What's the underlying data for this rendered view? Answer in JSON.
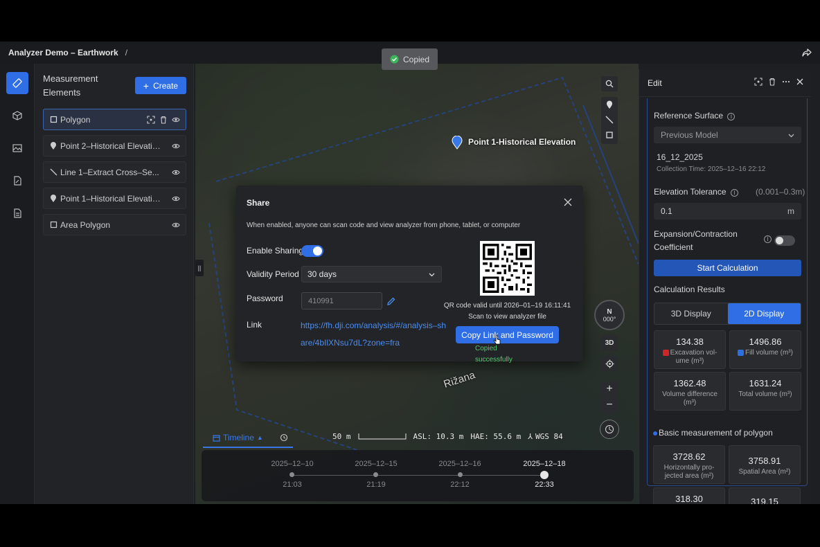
{
  "topbar": {
    "title": "Analyzer Demo – Earthwork",
    "separator": "/"
  },
  "toast": {
    "text": "Copied"
  },
  "panel": {
    "heading": "Measurement Elements",
    "create_label": "Create",
    "items": [
      {
        "label": "Polygon",
        "type": "polygon"
      },
      {
        "label": "Point 2–Historical Elevation",
        "type": "point"
      },
      {
        "label": "Line 1–Extract Cross–Se...",
        "type": "line"
      },
      {
        "label": "Point 1–Historical Elevation",
        "type": "point"
      },
      {
        "label": "Area Polygon",
        "type": "polygon"
      }
    ]
  },
  "map": {
    "point_label": "Point 1-Historical Elevation",
    "place_label": "Rižana",
    "compass": {
      "dir": "N",
      "deg": "000°"
    },
    "btn_3d": "3D",
    "scale": "50 m",
    "asl": "ASL: 10.3 m",
    "hae": "HAE: 55.6 m",
    "crs": "WGS 84"
  },
  "timeline": {
    "tab_label": "Timeline",
    "points": [
      {
        "date": "2025–12–10",
        "time": "21:03"
      },
      {
        "date": "2025–12–15",
        "time": "21:19"
      },
      {
        "date": "2025–12–16",
        "time": "22:12"
      },
      {
        "date": "2025–12–18",
        "time": "22:33",
        "current": true
      }
    ]
  },
  "dialog": {
    "title": "Share",
    "description": "When enabled, anyone can scan code and view analyzer from phone, tablet, or computer",
    "enable_label": "Enable Sharing",
    "sharing_enabled": true,
    "validity_label": "Validity Period",
    "validity_value": "30 days",
    "password_label": "Password",
    "password_value": "410991",
    "link_label": "Link",
    "link_value": "https://fh.dji.com/analysis/#/analysis–share/4bIlXNsu7dL?zone=fra",
    "qr_valid": "QR code valid until 2026–01–19 16:11:41",
    "qr_scan": "Scan to view analyzer file",
    "copy_button": "Copy Link and Password",
    "copied_msg": "Copied successfully"
  },
  "edit": {
    "title": "Edit",
    "reference_label": "Reference Surface",
    "reference_value": "Previous Model",
    "model_name": "16_12_2025",
    "collection_time": "Collection Time: 2025–12–16 22:12",
    "tolerance_label": "Elevation Tolerance",
    "tolerance_range": "(0.001–0.3m)",
    "tolerance_value": "0.1",
    "tolerance_unit": "m",
    "expansion_label": "Expansion/Contraction Coefficient",
    "start_button": "Start Calculation",
    "results_label": "Calculation Results",
    "tab_3d": "3D Display",
    "tab_2d": "2D Display",
    "stats": [
      {
        "value": "134.38",
        "label": "Excavation vol- ume (m³)",
        "color": "#d0262b"
      },
      {
        "value": "1496.86",
        "label": "Fill volume (m³)",
        "color": "#2c6fe0"
      },
      {
        "value": "1362.48",
        "label": "Volume difference (m³)"
      },
      {
        "value": "1631.24",
        "label": "Total volume (m³)"
      }
    ],
    "basic_label": "Basic measurement of polygon",
    "basic_stats": [
      {
        "value": "3728.62",
        "label": "Horizontally pro- jected area (m²)"
      },
      {
        "value": "3758.91",
        "label": "Spatial Area (m²)"
      },
      {
        "value": "318.30",
        "label": ""
      },
      {
        "value": "319.15",
        "label": ""
      }
    ]
  },
  "colors": {
    "accent": "#2f6ee5",
    "success": "#4fcf6b",
    "link": "#4b8df0"
  }
}
